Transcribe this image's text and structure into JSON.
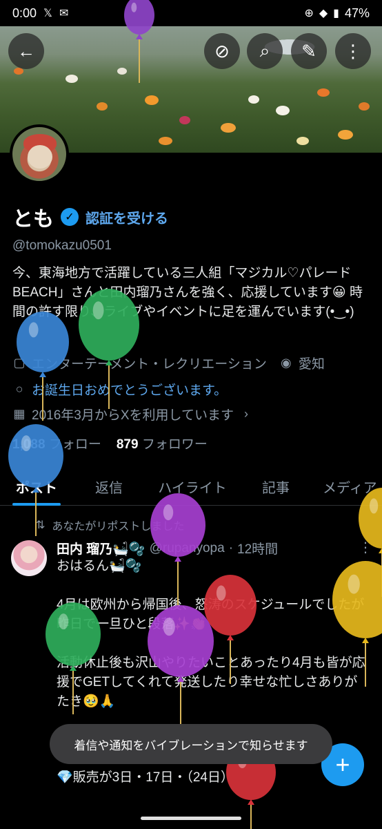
{
  "status_bar": {
    "time": "0:00",
    "battery": "47%",
    "icons": [
      "x-logo-icon",
      "mail-icon",
      "data-saver-icon",
      "wifi-icon",
      "battery-icon"
    ]
  },
  "top_actions": {
    "icons": [
      "back-arrow-icon",
      "mute-icon",
      "search-icon",
      "edit-icon",
      "more-vertical-icon"
    ]
  },
  "profile": {
    "name": "とも",
    "verify_link": "認証を受ける",
    "handle": "@tomokazu0501",
    "bio": "今、東海地方で活躍している三人組「マジカル♡パレードBEACH」さんと田内瑠乃さんを強く、応援しています😀 時間の許す限り、ライブやイベントに足を運んでいます(•‿•)",
    "category": "エンターテーメント・レクリエーション",
    "location": "愛知",
    "birthday": "お誕生日おめでとうございます。",
    "joined": "2016年3月からXを利用しています",
    "following_count": "1,088",
    "following_label": "フォロー",
    "followers_count": "879",
    "followers_label": "フォロワー"
  },
  "tabs": [
    "ポスト",
    "返信",
    "ハイライト",
    "記事",
    "メディア"
  ],
  "post": {
    "repost_text": "あなたがリポストしました",
    "author": "田内 瑠乃🛀🫧",
    "author_handle": "@rupanyopa",
    "time": "12時間",
    "body": "おはるん🛀🫧\n\n4月は欧州から帰国後、怒涛のスケジュールでしたが昨日で一旦ひと段落✨👏\n\n活動休止後も沢山やりたいことあったり4月も皆が応援でGETしてくれて発送したり幸せな忙しさありがたき🥹🙏",
    "body_hidden_line": "💎販売が3日・17日・（24日）"
  },
  "toast": "着信や通知をバイブレーションで知らせます",
  "fab": "+",
  "colors": {
    "accent": "#1d9bf0",
    "link": "#5ea8ee",
    "muted": "#8b98a5",
    "background": "#000000"
  },
  "balloons": [
    {
      "color": "#8e44c9"
    },
    {
      "color": "#2fae5b"
    },
    {
      "color": "#3a86d6"
    },
    {
      "color": "#3a86d6"
    },
    {
      "color": "#a63fd0"
    },
    {
      "color": "#2fae5b"
    },
    {
      "color": "#d8323a"
    },
    {
      "color": "#a63fd0"
    },
    {
      "color": "#e6b81c"
    },
    {
      "color": "#e6b81c"
    },
    {
      "color": "#d8323a"
    }
  ]
}
